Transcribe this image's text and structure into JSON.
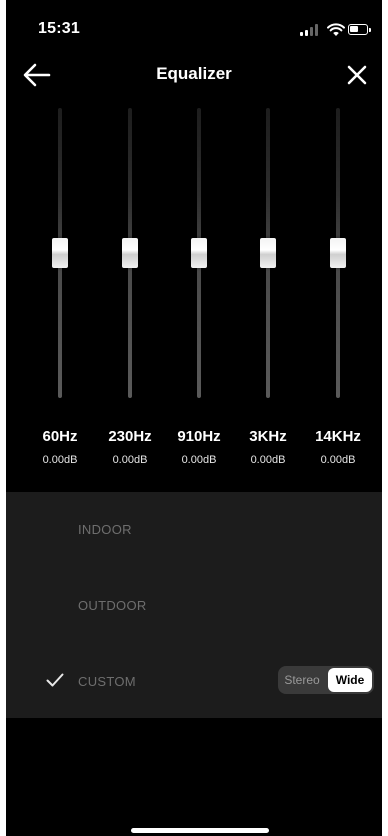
{
  "status_bar": {
    "time": "15:31",
    "icons": [
      "signal-icon",
      "wifi-icon",
      "battery-icon"
    ]
  },
  "header": {
    "title": "Equalizer",
    "back_icon": "arrow-left-icon",
    "close_icon": "close-icon"
  },
  "equalizer": {
    "bands": [
      {
        "freq": "60Hz",
        "gain": "0.00dB",
        "level": 0.5
      },
      {
        "freq": "230Hz",
        "gain": "0.00dB",
        "level": 0.5
      },
      {
        "freq": "910Hz",
        "gain": "0.00dB",
        "level": 0.5
      },
      {
        "freq": "3KHz",
        "gain": "0.00dB",
        "level": 0.5
      },
      {
        "freq": "14KHz",
        "gain": "0.00dB",
        "level": 0.5
      }
    ]
  },
  "modes": {
    "items": [
      {
        "label": "INDOOR",
        "selected": false
      },
      {
        "label": "OUTDOOR",
        "selected": false
      },
      {
        "label": "CUSTOM",
        "selected": true
      }
    ],
    "stereo_toggle": {
      "options": [
        "Stereo",
        "Wide"
      ],
      "selected": "Wide"
    }
  },
  "colors": {
    "background": "#000000",
    "panel": "#1c1c1c",
    "mode_text": "#6e6e6e",
    "accent": "#ffffff"
  }
}
